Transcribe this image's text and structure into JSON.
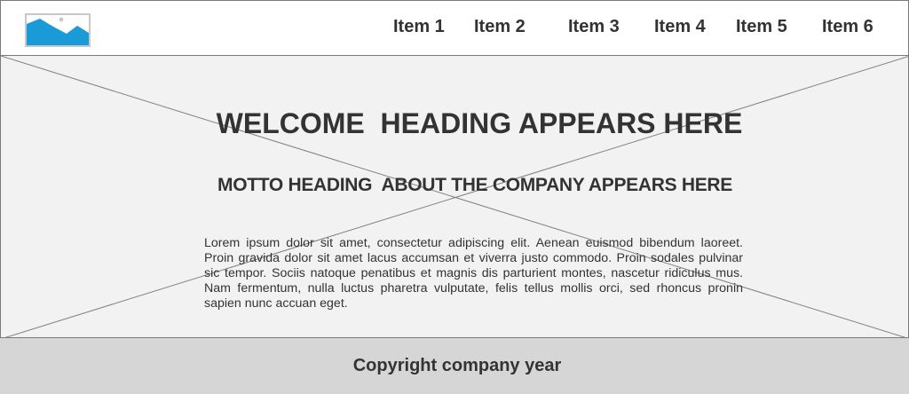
{
  "header": {
    "logo_icon": "image-placeholder-icon",
    "nav_items": [
      {
        "label": "Item 1"
      },
      {
        "label": "Item 2"
      },
      {
        "label": "Item 3"
      },
      {
        "label": "Item 4"
      },
      {
        "label": "Item 5"
      },
      {
        "label": "Item 6"
      }
    ]
  },
  "hero": {
    "background_icon": "image-placeholder-x",
    "welcome_heading": "WELCOME  HEADING APPEARS HERE",
    "motto_heading": "MOTTO HEADING  ABOUT THE COMPANY APPEARS HERE",
    "body_text": "Lorem ipsum dolor sit amet, consectetur adipiscing elit. Aenean euismod bibendum laoreet. Proin gravida dolor sit amet lacus accumsan et viverra justo commodo. Proin sodales pulvinar sic tempor. Sociis natoque penatibus et magnis dis parturient montes, nascetur ridiculus mus. Nam fermentum, nulla luctus pharetra vulputate, felis tellus mollis orci, sed rhoncus pronin sapien nunc accuan eget."
  },
  "footer": {
    "copyright": "Copyright company year"
  },
  "colors": {
    "logo_blue": "#1a9bd7",
    "hero_background": "#f2f2f2",
    "footer_background": "#d6d6d6",
    "text": "#333333"
  }
}
